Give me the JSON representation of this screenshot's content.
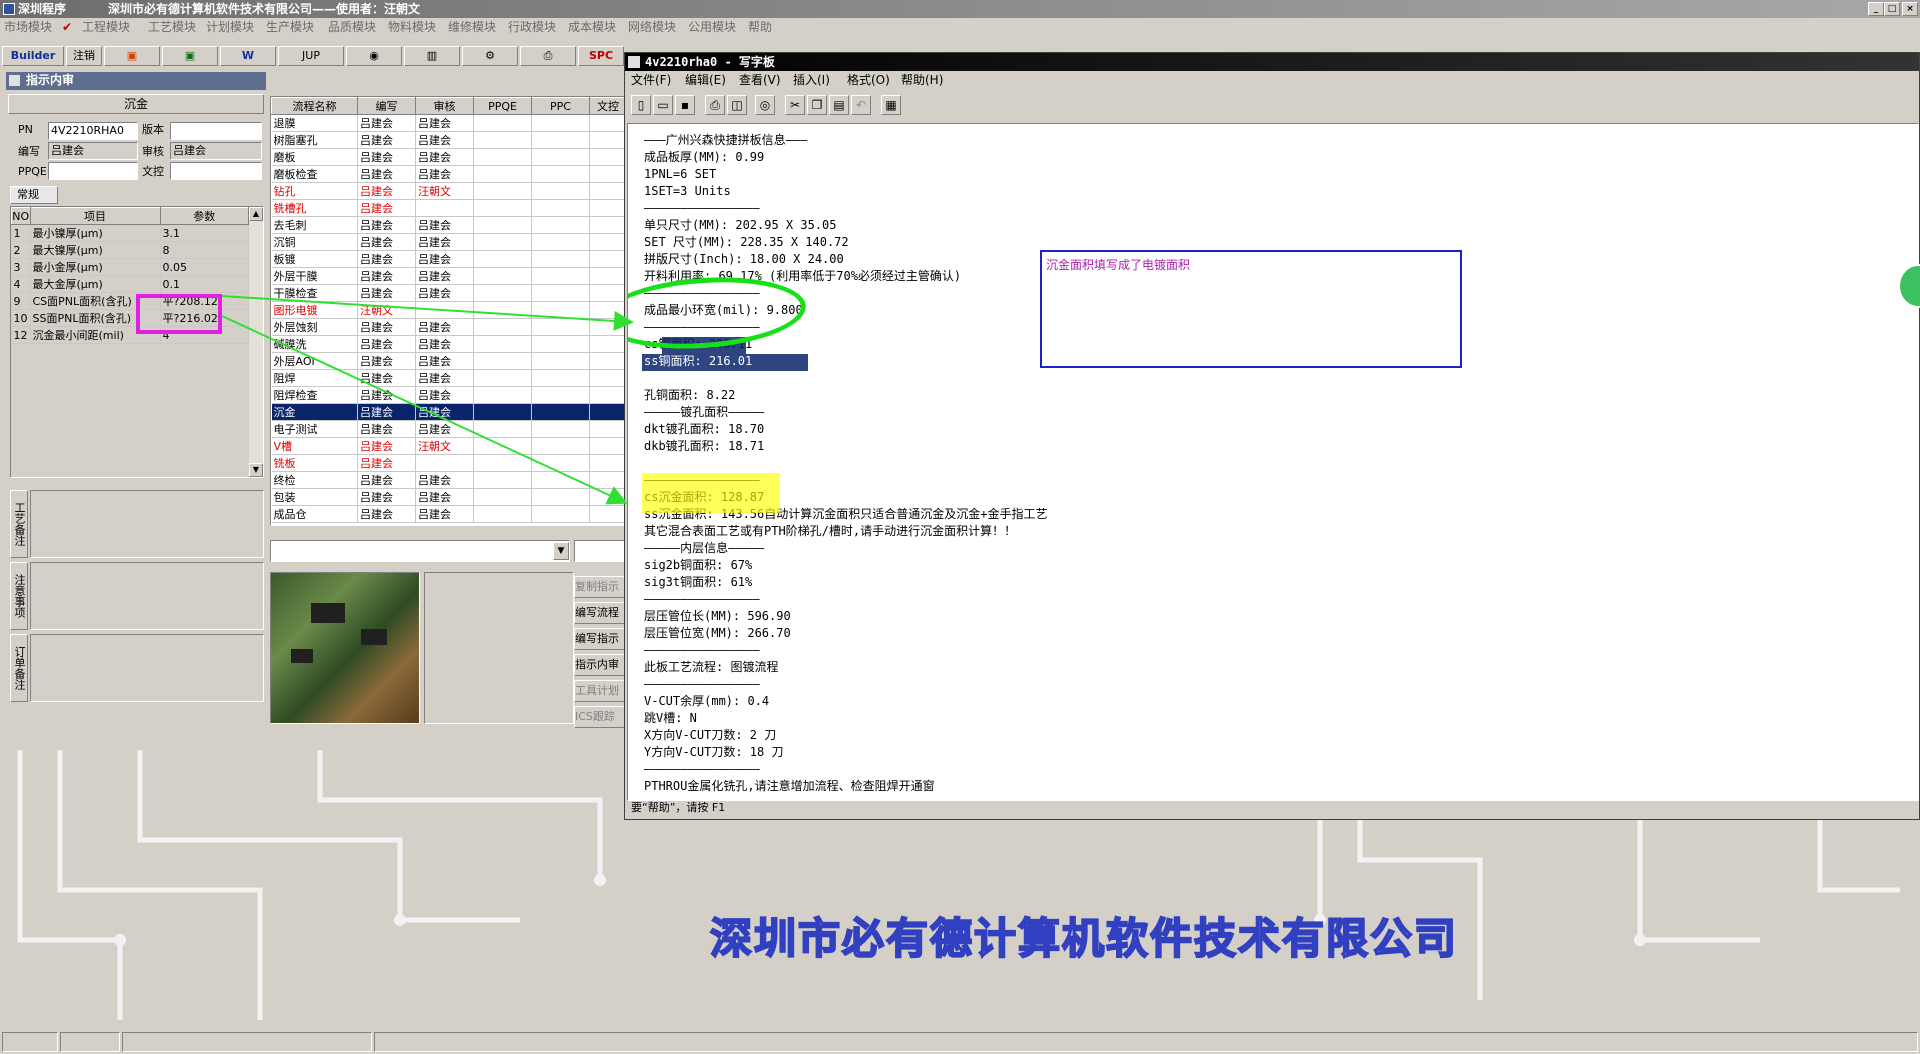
{
  "app": {
    "title": "深圳程序",
    "company_user": "深圳市必有德计算机软件技术有限公司——使用者：汪朝文"
  },
  "menu": [
    "市场模块",
    "工程模块",
    "工艺模块",
    "计划模块",
    "生产模块",
    "品质模块",
    "物料模块",
    "维修模块",
    "行政模块",
    "成本模块",
    "网络模块",
    "公用模块",
    "帮助"
  ],
  "toolbar": {
    "builder": "Builder",
    "logout": "注销",
    "jup": "JUP",
    "spc": "SPC"
  },
  "panel": {
    "title": "指示内审",
    "section_title": "沉金",
    "pn_label": "PN",
    "pn_value": "4V2210RHA0",
    "version_label": "版本",
    "version_value": "",
    "editor_label": "编写",
    "editor_value": "吕建会",
    "reviewer_label": "审核",
    "reviewer_value": "吕建会",
    "ppqe_label": "PPQE",
    "ppqe_value": "",
    "doc_label": "文控",
    "doc_value": "",
    "tab_label": "常规",
    "params_headers": [
      "NO",
      "项目",
      "参数"
    ],
    "params": [
      {
        "no": "1",
        "item": "最小镍厚(μm)",
        "value": "3.1"
      },
      {
        "no": "2",
        "item": "最大镍厚(μm)",
        "value": "8"
      },
      {
        "no": "3",
        "item": "最小金厚(μm)",
        "value": "0.05"
      },
      {
        "no": "4",
        "item": "最大金厚(μm)",
        "value": "0.1"
      },
      {
        "no": "9",
        "item": "CS面PNL面积(含孔)",
        "value": "平?208.12"
      },
      {
        "no": "10",
        "item": "SS面PNL面积(含孔)",
        "value": "平?216.02"
      },
      {
        "no": "12",
        "item": "沉金最小间距(mil)",
        "value": "4"
      }
    ],
    "side_tabs": [
      "工艺备注",
      "注意事项",
      "订单备注"
    ]
  },
  "process": {
    "headers": [
      "流程名称",
      "编写",
      "审核",
      "PPQE",
      "PPC",
      "文控"
    ],
    "rows": [
      {
        "name": "退膜",
        "editor": "吕建会",
        "reviewer": "吕建会",
        "red": false
      },
      {
        "name": "树脂塞孔",
        "editor": "吕建会",
        "reviewer": "吕建会",
        "red": false
      },
      {
        "name": "磨板",
        "editor": "吕建会",
        "reviewer": "吕建会",
        "red": false
      },
      {
        "name": "磨板检查",
        "editor": "吕建会",
        "reviewer": "吕建会",
        "red": false
      },
      {
        "name": "钻孔",
        "editor": "吕建会",
        "reviewer": "汪朝文",
        "red": true
      },
      {
        "name": "铣槽孔",
        "editor": "吕建会",
        "reviewer": "",
        "red": true
      },
      {
        "name": "去毛刺",
        "editor": "吕建会",
        "reviewer": "吕建会",
        "red": false
      },
      {
        "name": "沉铜",
        "editor": "吕建会",
        "reviewer": "吕建会",
        "red": false
      },
      {
        "name": "板镀",
        "editor": "吕建会",
        "reviewer": "吕建会",
        "red": false
      },
      {
        "name": "外层干膜",
        "editor": "吕建会",
        "reviewer": "吕建会",
        "red": false
      },
      {
        "name": "干膜检查",
        "editor": "吕建会",
        "reviewer": "吕建会",
        "red": false
      },
      {
        "name": "图形电镀",
        "editor": "汪朝文",
        "reviewer": "",
        "red": true
      },
      {
        "name": "外层蚀刻",
        "editor": "吕建会",
        "reviewer": "吕建会",
        "red": false
      },
      {
        "name": "碱膜洗",
        "editor": "吕建会",
        "reviewer": "吕建会",
        "red": false
      },
      {
        "name": "外层AOI",
        "editor": "吕建会",
        "reviewer": "吕建会",
        "red": false
      },
      {
        "name": "阻焊",
        "editor": "吕建会",
        "reviewer": "吕建会",
        "red": false
      },
      {
        "name": "阻焊检查",
        "editor": "吕建会",
        "reviewer": "吕建会",
        "red": false
      },
      {
        "name": "沉金",
        "editor": "吕建会",
        "reviewer": "吕建会",
        "red": false,
        "selected": true
      },
      {
        "name": "电子测试",
        "editor": "吕建会",
        "reviewer": "吕建会",
        "red": false
      },
      {
        "name": "V槽",
        "editor": "吕建会",
        "reviewer": "汪朝文",
        "red": true
      },
      {
        "name": "铣板",
        "editor": "吕建会",
        "reviewer": "",
        "red": true
      },
      {
        "name": "终检",
        "editor": "吕建会",
        "reviewer": "吕建会",
        "red": false
      },
      {
        "name": "包装",
        "editor": "吕建会",
        "reviewer": "吕建会",
        "red": false
      },
      {
        "name": "成品仓",
        "editor": "吕建会",
        "reviewer": "吕建会",
        "red": false
      }
    ],
    "side_buttons": [
      "复制指示",
      "编写流程",
      "编写指示",
      "指示内审",
      "工具计划",
      "ICS跟踪"
    ]
  },
  "wordpad": {
    "title": "4v2210rha0 - 写字板",
    "menu": [
      "文件(F)",
      "编辑(E)",
      "查看(V)",
      "插入(I)",
      "格式(O)",
      "帮助(H)"
    ],
    "status": "要“帮助”，请按 F1",
    "annotation": "沉金面积填写成了电镀面积",
    "lines": [
      "———广州兴森快捷拼板信息———",
      "成品板厚(MM): 0.99",
      "1PNL=6 SET",
      "1SET=3 Units",
      "————————————————",
      "单只尺寸(MM): 202.95 X 35.05",
      "SET 尺寸(MM): 228.35 X 140.72",
      "拼版尺寸(Inch): 18.00 X 24.00",
      "开料利用率: 69.17% (利用率低于70%必须经过主管确认)",
      "————————————————",
      "成品最小环宽(mil): 9.800",
      "————————————————",
      "cs铜面积: 208.11",
      "ss铜面积: 216.01",
      "铜面积(含板面积): 437.26",
      "孔铜面积: 8.22",
      "—————镀孔面积—————",
      "dkt镀孔面积: 18.70",
      "dkb镀孔面积: 18.71",
      "",
      "————————————————",
      "cs沉金面积: 128.87",
      "ss沉金面积: 143.56自动计算沉金面积只适合普通沉金及沉金+金手指工艺",
      "其它混合表面工艺或有PTH阶梯孔/槽时,请手动进行沉金面积计算！！",
      "—————内层信息—————",
      "sig2b铜面积: 67%",
      "sig3t铜面积: 61%",
      "————————————————",
      "层压管位长(MM): 596.90",
      "层压管位宽(MM): 266.70",
      "————————————————",
      "此板工艺流程: 图镀流程",
      "————————————————",
      "V-CUT余厚(mm): 0.4",
      "跳V槽: N",
      "X方向V-CUT刀数: 2 刀",
      "Y方向V-CUT刀数: 18 刀",
      "————————————————",
      "PTHROU金属化铣孔,请注意增加流程、检查阻焊开通窗"
    ]
  },
  "footer": {
    "watermark": "深圳市必有德计算机软件技术有限公司"
  }
}
